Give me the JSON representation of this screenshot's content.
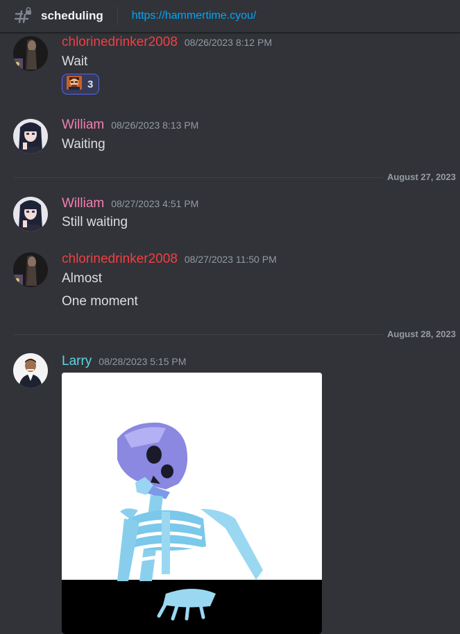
{
  "channel": {
    "name": "scheduling",
    "topic": "https://hammertime.cyou/",
    "icon": "hash-thread-icon"
  },
  "colors": {
    "background": "#313338",
    "author_chlorine": "#f23f43",
    "author_william": "#f47fb0",
    "author_larry": "#5cd6e6",
    "link": "#00a8fc",
    "timestamp": "#949ba4"
  },
  "messages": [
    {
      "author": "chlorinedrinker2008",
      "timestamp": "08/26/2023 8:12 PM",
      "lines": [
        "Wait"
      ],
      "reaction": {
        "emoji": "face-emoji",
        "count": "3"
      }
    },
    {
      "author": "William",
      "timestamp": "08/26/2023 8:13 PM",
      "lines": [
        "Waiting"
      ]
    },
    {
      "author": "William",
      "timestamp": "08/27/2023 4:51 PM",
      "lines": [
        "Still waiting"
      ]
    },
    {
      "author": "chlorinedrinker2008",
      "timestamp": "08/27/2023 11:50 PM",
      "lines": [
        "Almost",
        "One moment"
      ]
    },
    {
      "author": "Larry",
      "timestamp": "08/28/2023 5:15 PM",
      "attachment": "skeleton-waiting-gif"
    }
  ],
  "dividers": [
    "August 27, 2023",
    "August 28, 2023"
  ]
}
